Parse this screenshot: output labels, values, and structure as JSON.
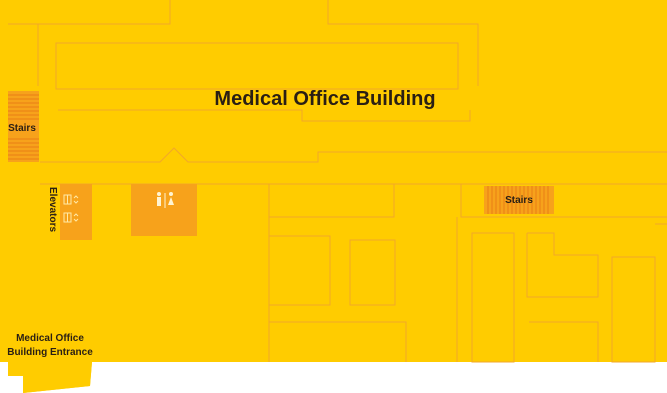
{
  "map": {
    "title": "Medical Office Building",
    "labels": {
      "stairs_left": "Stairs",
      "stairs_right": "Stairs",
      "elevators": "Elevators",
      "entrance": "Medical Office Building Entrance"
    },
    "icons": [
      "restroom-icon",
      "elevator-icon"
    ],
    "colors": {
      "floor": "#FFCC00",
      "wall": "#F2A72A",
      "amenity": "#F7A21B",
      "stair_fill": "#F7A21B",
      "stair_line": "#E97F14",
      "text": "#2A1F14",
      "background": "#FFFFFF"
    }
  }
}
